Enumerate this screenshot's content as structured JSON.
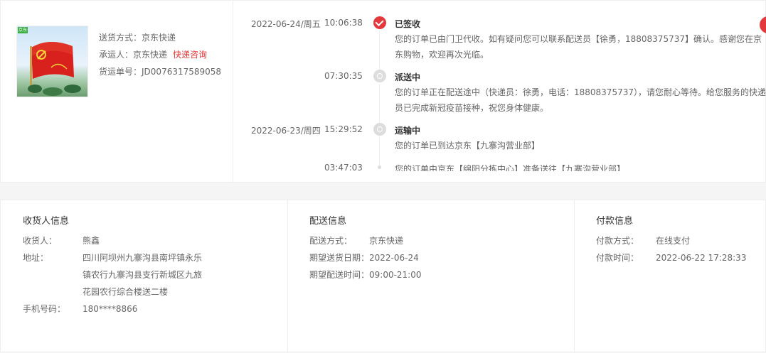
{
  "order": {
    "badge": "京东",
    "ship_method_label": "送货方式：",
    "ship_method_value": "京东快递",
    "carrier_label": "承运人：",
    "carrier_value": "京东快递",
    "carrier_link": "快递咨询",
    "waybill_label": "货运单号：",
    "waybill_value": "JD0076317589058"
  },
  "tracking": [
    {
      "date": "2022-06-24/周五",
      "time": "10:06:38",
      "status": "已签收",
      "desc": "您的订单已由门卫代收。如有疑问您可以联系配送员【徐勇，18808375737】确认。感谢您在京东购物，欢迎再次光临。",
      "icon": "check-icon"
    },
    {
      "date": "",
      "time": "07:30:35",
      "status": "派送中",
      "desc": "您的订单正在配送途中（快递员：徐勇，电话：18808375737），请您耐心等待。给您服务的快递员已完成新冠疫苗接种，祝您身体健康。",
      "icon": "delivery-icon"
    },
    {
      "date": "2022-06-23/周四",
      "time": "15:29:52",
      "status": "运输中",
      "desc": "您的订单已到达京东【九寨沟营业部】",
      "icon": "truck-icon"
    },
    {
      "date": "",
      "time": "03:47:03",
      "status": "",
      "desc": "您的订单由京东【绵阳分拣中心】准备送往【九寨沟营业部】",
      "icon": "dot-icon"
    }
  ],
  "receiver": {
    "title": "收货人信息",
    "name_label": "收货人：",
    "name_value": "熊鑫",
    "address_label": "地址：",
    "address_lines": [
      "四川阿坝州九寨沟县南坪镇永乐",
      "镇农行九寨沟县支行新城区九旅",
      "花园农行综合楼送二楼"
    ],
    "phone_label": "手机号码：",
    "phone_value": "180****8866"
  },
  "delivery": {
    "title": "配送信息",
    "method_label": "配送方式：",
    "method_value": "京东快递",
    "date_label": "期望送货日期：",
    "date_value": "2022-06-24",
    "time_label": "期望配送时间：",
    "time_value": "09:00-21:00"
  },
  "payment": {
    "title": "付款信息",
    "method_label": "付款方式：",
    "method_value": "在线支付",
    "time_label": "付款时间：",
    "time_value": "2022-06-22 17:28:33"
  },
  "colors": {
    "accent": "#e4393c",
    "inactive": "#dddddd",
    "text": "#666666",
    "heading": "#333333"
  }
}
